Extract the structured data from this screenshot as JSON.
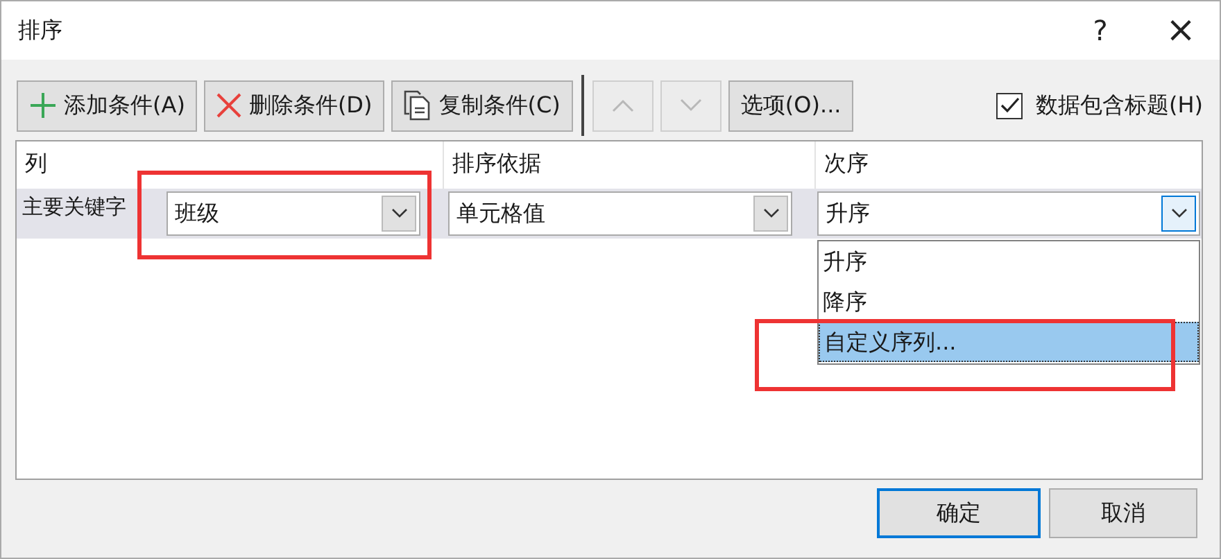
{
  "window": {
    "title": "排序",
    "help": "?",
    "close": "×"
  },
  "toolbar": {
    "buttons": [
      {
        "kind": "add",
        "label": "添加条件(A)",
        "disabled": false
      },
      {
        "kind": "delete",
        "label": "删除条件(D)",
        "disabled": false
      },
      {
        "kind": "copy",
        "label": "复制条件(C)",
        "disabled": false
      },
      {
        "kind": "up",
        "disabled": true
      },
      {
        "kind": "down",
        "disabled": true
      },
      {
        "kind": "text",
        "label": "选项(O)...",
        "disabled": false
      }
    ],
    "header_checkbox": {
      "label": "数据包含标题(H)",
      "checked": true
    }
  },
  "table": {
    "columns": [
      "列",
      "排序依据",
      "次序"
    ],
    "rows": [
      {
        "label": "主要关键字",
        "column": "班级",
        "sort_on": "单元格值",
        "order": "升序",
        "selected": true
      }
    ]
  },
  "dropdown": {
    "options": [
      {
        "label": "升序",
        "selected": false
      },
      {
        "label": "降序",
        "selected": false
      },
      {
        "label": "自定义序列...",
        "selected": true
      }
    ]
  },
  "buttons": [
    {
      "label": "确定",
      "default": true
    },
    {
      "label": "取消",
      "default": false
    }
  ],
  "annotations": [
    {
      "kind": "frame",
      "color": "#ee3333"
    },
    {
      "kind": "frame",
      "color": "#ee3333"
    }
  ]
}
